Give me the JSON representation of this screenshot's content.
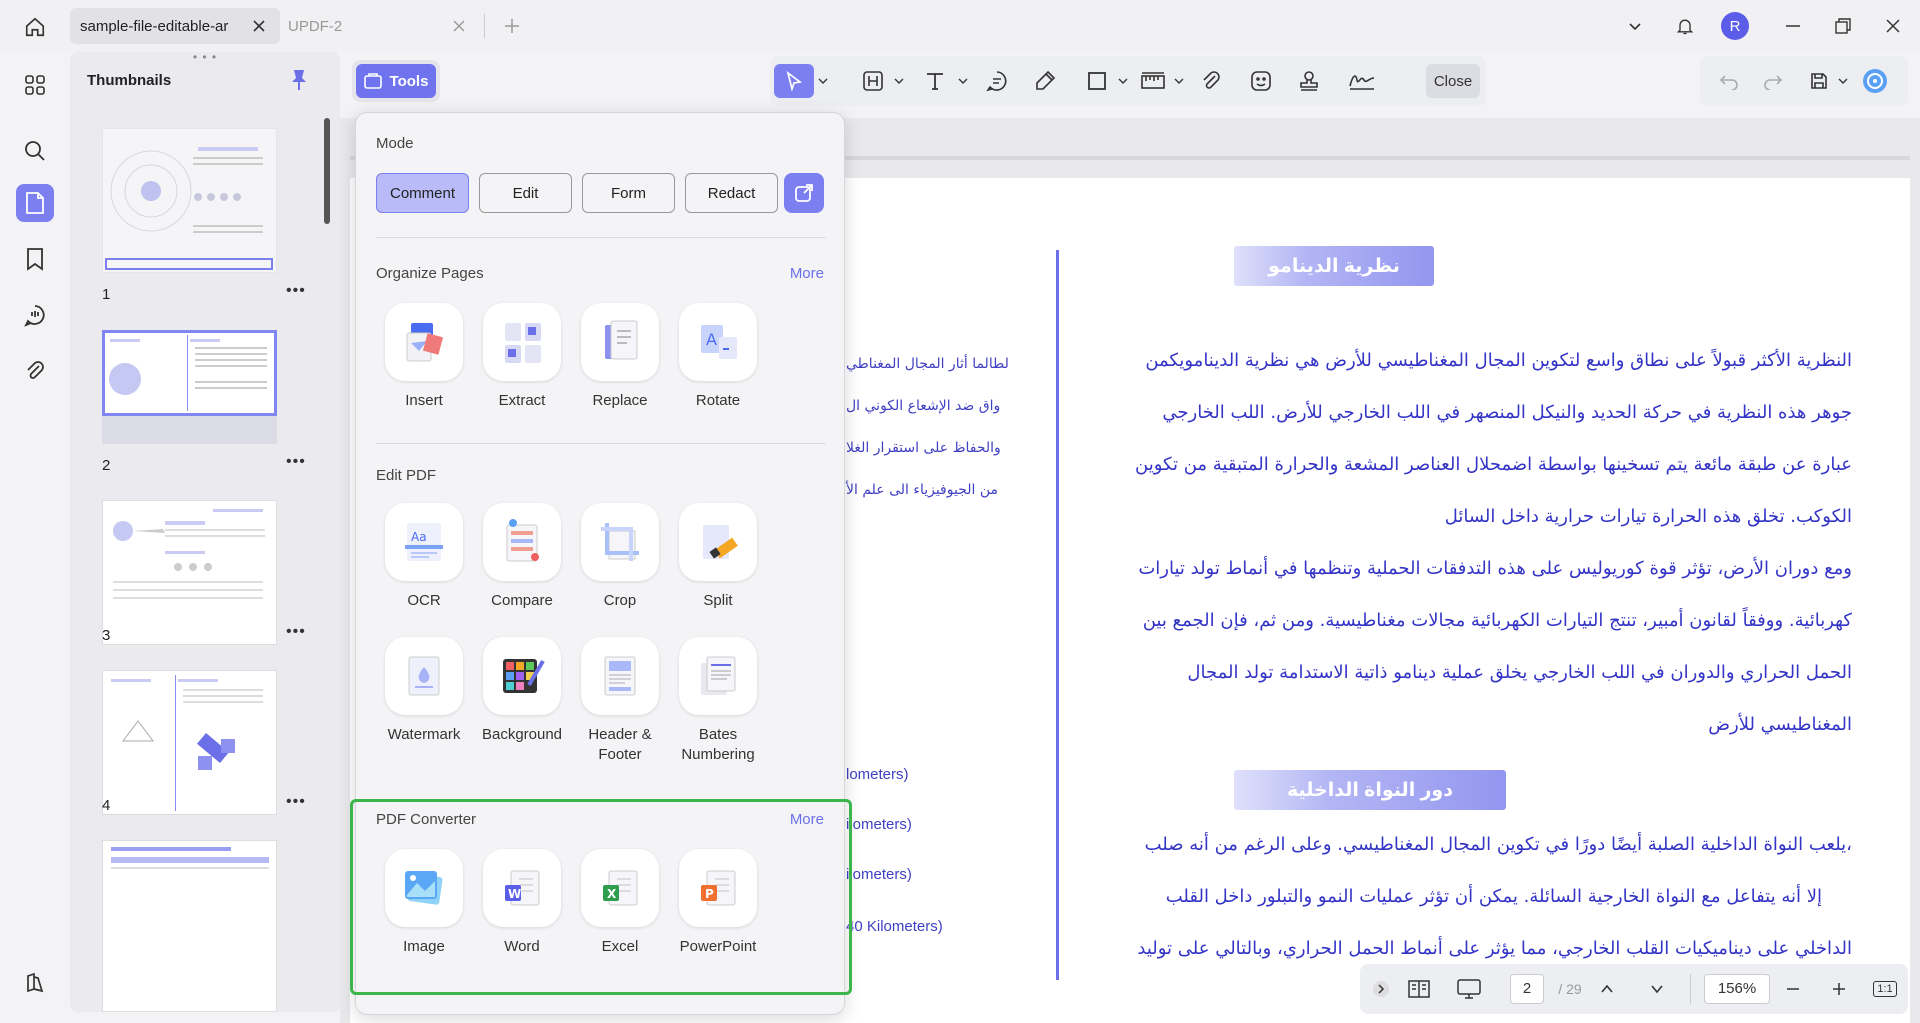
{
  "tabs": [
    {
      "label": "sample-file-editable-ar"
    },
    {
      "label": "UPDF-2"
    }
  ],
  "user": {
    "initial": "R"
  },
  "thumbnails": {
    "title": "Thumbnails",
    "grip": "• • •",
    "more": "•••",
    "pages": [
      "1",
      "2",
      "3",
      "4"
    ]
  },
  "toolbar": {
    "tools_label": "Tools",
    "close_label": "Close"
  },
  "tools_panel": {
    "mode_label": "Mode",
    "modes": [
      "Comment",
      "Edit",
      "Form",
      "Redact"
    ],
    "organize": {
      "label": "Organize Pages",
      "more": "More",
      "items": [
        "Insert",
        "Extract",
        "Replace",
        "Rotate"
      ]
    },
    "edit": {
      "label": "Edit PDF",
      "items": [
        "OCR",
        "Compare",
        "Crop",
        "Split",
        "Watermark",
        "Background",
        "Header & Footer",
        "Bates Numbering"
      ]
    },
    "converter": {
      "label": "PDF Converter",
      "more": "More",
      "items": [
        "Image",
        "Word",
        "Excel",
        "PowerPoint"
      ]
    }
  },
  "document": {
    "heading1": "نظرية الدينامو",
    "heading2": "دور النواة الداخلية",
    "right_lines": [
      "النظرية الأكثر قبولاً على نطاق واسع لتكوين المجال المغناطيسي للأرض هي نظرية الدينامويكمن",
      "جوهر هذه النظرية في حركة الحديد والنيكل المنصهر في اللب الخارجي للأرض. اللب الخارجي",
      "عبارة عن طبقة مائعة يتم تسخينها بواسطة اضمحلال العناصر المشعة والحرارة المتبقية من تكوين",
      "الكوكب. تخلق هذه الحرارة تيارات حرارية داخل السائل",
      "ومع دوران الأرض، تؤثر قوة كوريوليس على هذه التدفقات الحملية وتنظمها في أنماط تولد تيارات",
      "كهربائية. ووفقاً لقانون أمبير، تنتج التيارات الكهربائية مجالات مغناطيسية. ومن ثم، فإن الجمع بين",
      "الحمل الحراري والدوران في اللب الخارجي يخلق عملية دينامو ذاتية الاستدامة تولد المجال",
      "المغناطيسي للأرض"
    ],
    "inner_core_lines": [
      "،يلعب النواة الداخلية الصلبة أيضًا دورًا في تكوين المجال المغناطيسي. وعلى الرغم من أنه صلب",
      "إلا أنه يتفاعل مع النواة الخارجية السائلة. يمكن أن تؤثر عمليات النمو والتبلور داخل القلب",
      "الداخلي على ديناميكيات القلب الخارجي، مما يؤثر على أنماط الحمل الحراري، وبالتالي على توليد"
    ],
    "left_lines": [
      "لطالما أثار المجال المغناطي",
      "واق ضد الإشعاع الكوني ال",
      "والحفاظ على استقرار الغلا",
      "من الجيوفيزياء الى علم الأ"
    ],
    "km_lines": [
      "lometers)",
      "ilometers)",
      "ilometers)",
      "40 Kilometers)"
    ]
  },
  "navigation": {
    "current_page": "2",
    "total_pages": "/ 29",
    "zoom": "156%",
    "fit_label": "1:1"
  },
  "colors": {
    "accent": "#7b7ff0",
    "highlight": "#3cb64b",
    "text_blue": "#3333c6"
  }
}
